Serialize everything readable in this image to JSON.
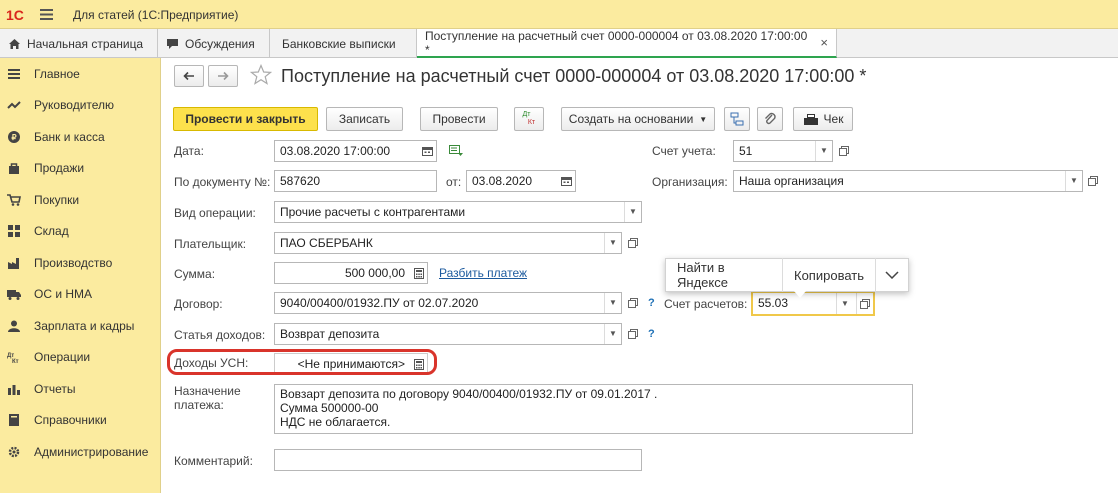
{
  "app": {
    "logo": "1С",
    "title": "Для статей  (1С:Предприятие)"
  },
  "tabs": [
    {
      "label": "Начальная страница",
      "icon": "home-icon"
    },
    {
      "label": "Обсуждения",
      "icon": "chat-icon"
    },
    {
      "label": "Банковские выписки"
    },
    {
      "label": "Поступление на расчетный счет 0000-000004 от 03.08.2020 17:00:00 *",
      "close": "×"
    }
  ],
  "sidebar": {
    "items": [
      {
        "label": "Главное",
        "icon": "menu-icon"
      },
      {
        "label": "Руководителю",
        "icon": "trend-icon"
      },
      {
        "label": "Банк и касса",
        "icon": "coin-icon"
      },
      {
        "label": "Продажи",
        "icon": "bag-icon"
      },
      {
        "label": "Покупки",
        "icon": "cart-icon"
      },
      {
        "label": "Склад",
        "icon": "warehouse-icon"
      },
      {
        "label": "Производство",
        "icon": "factory-icon"
      },
      {
        "label": "ОС и НМА",
        "icon": "truck-icon"
      },
      {
        "label": "Зарплата и кадры",
        "icon": "person-icon"
      },
      {
        "label": "Операции",
        "icon": "dt-kt-icon"
      },
      {
        "label": "Отчеты",
        "icon": "bar-chart-icon"
      },
      {
        "label": "Справочники",
        "icon": "book-icon"
      },
      {
        "label": "Администрирование",
        "icon": "gear-icon"
      }
    ]
  },
  "doc": {
    "title": "Поступление на расчетный счет 0000-000004 от 03.08.2020 17:00:00 *"
  },
  "toolbar": {
    "post_close": "Провести и закрыть",
    "save": "Записать",
    "post": "Провести",
    "dtkt_top": "Дт",
    "dtkt_bottom": "Кт",
    "create_based": "Создать на основании",
    "receipt": "Чек"
  },
  "form": {
    "date_label": "Дата:",
    "date_value": "03.08.2020 17:00:00",
    "account_label": "Счет учета:",
    "account_value": "51",
    "docnum_label": "По документу №:",
    "docnum_value": "587620",
    "from_label": "от:",
    "from_value": "03.08.2020",
    "org_label": "Организация:",
    "org_value": "Наша организация",
    "optype_label": "Вид операции:",
    "optype_value": "Прочие расчеты с контрагентами",
    "payer_label": "Плательщик:",
    "payer_value": "ПАО СБЕРБАНК",
    "sum_label": "Сумма:",
    "sum_value": "500 000,00",
    "split_link": "Разбить платеж",
    "contract_label": "Договор:",
    "contract_value": "9040/00400/01932.ПУ от 02.07.2020",
    "settle_label": "Счет расчетов:",
    "settle_value": "55.03",
    "income_item_label": "Статья доходов:",
    "income_item_value": "Возврат депозита",
    "usn_label": "Доходы УСН:",
    "usn_value": "<Не принимаются>",
    "purpose_label_1": "Назначение",
    "purpose_label_2": "платежа:",
    "purpose_line_1": "Вовзарт депозита по договору 9040/00400/01932.ПУ от 09.01.2017 .",
    "purpose_line_2": "Сумма 500000-00",
    "purpose_line_3": "НДС не облагается.",
    "comment_label": "Комментарий:",
    "comment_value": "",
    "help": "?"
  },
  "popup": {
    "find": "Найти в Яндексе",
    "copy": "Копировать"
  },
  "colors": {
    "sidebar_bg": "#fbeb9f",
    "primary_btn": "#fde14c",
    "highlight": "#d9342b",
    "active_tab": "#2ea44f"
  }
}
